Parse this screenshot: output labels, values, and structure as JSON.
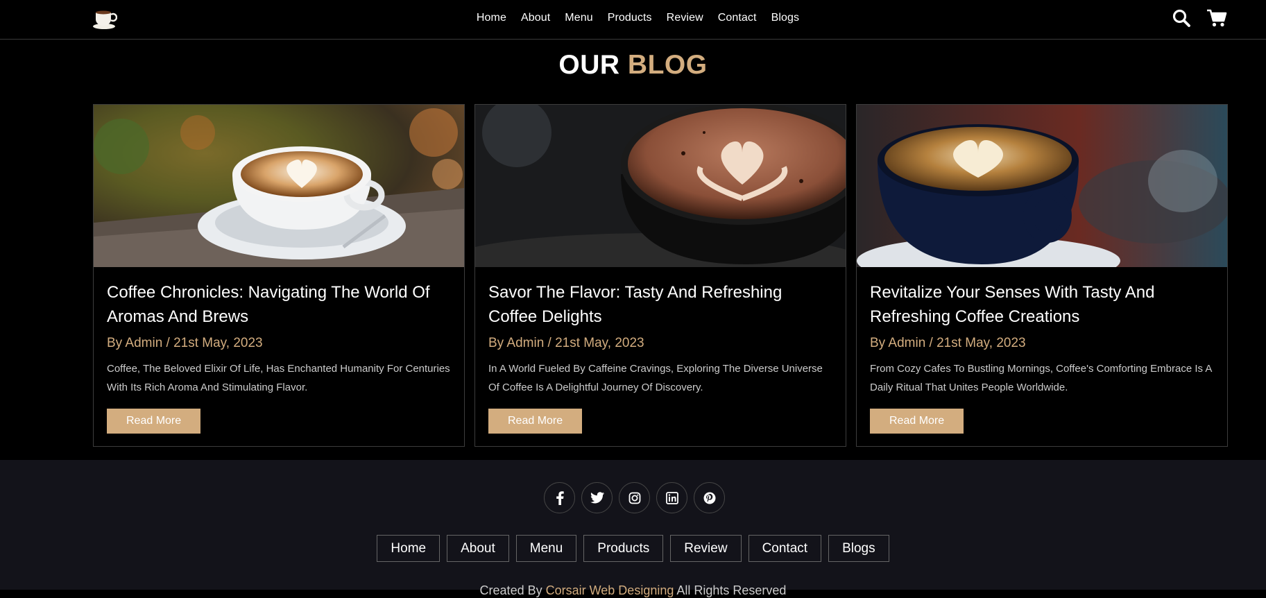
{
  "header": {
    "nav": [
      "Home",
      "About",
      "Menu",
      "Products",
      "Review",
      "Contact",
      "Blogs"
    ]
  },
  "section": {
    "title_main": "OUR",
    "title_accent": "BLOG"
  },
  "cards": [
    {
      "title": "Coffee Chronicles: Navigating The World Of Aromas And Brews",
      "meta": "By Admin / 21st May, 2023",
      "text": "Coffee, The Beloved Elixir Of Life, Has Enchanted Humanity For Centuries With Its Rich Aroma And Stimulating Flavor.",
      "button": "Read More"
    },
    {
      "title": "Savor The Flavor: Tasty And Refreshing Coffee Delights",
      "meta": "By Admin / 21st May, 2023",
      "text": "In A World Fueled By Caffeine Cravings, Exploring The Diverse Universe Of Coffee Is A Delightful Journey Of Discovery.",
      "button": "Read More"
    },
    {
      "title": "Revitalize Your Senses With Tasty And Refreshing Coffee Creations",
      "meta": "By Admin / 21st May, 2023",
      "text": "From Cozy Cafes To Bustling Mornings, Coffee's Comforting Embrace Is A Daily Ritual That Unites People Worldwide.",
      "button": "Read More"
    }
  ],
  "footer": {
    "socials": [
      "facebook-icon",
      "twitter-icon",
      "instagram-icon",
      "linkedin-icon",
      "pinterest-icon"
    ],
    "links": [
      "Home",
      "About",
      "Menu",
      "Products",
      "Review",
      "Contact",
      "Blogs"
    ],
    "credit_prefix": "Created By",
    "credit_name": "Corsair Web Designing",
    "credit_suffix": "All Rights Reserved"
  },
  "colors": {
    "accent": "#d3ad7f",
    "footer_bg": "#13131a"
  }
}
